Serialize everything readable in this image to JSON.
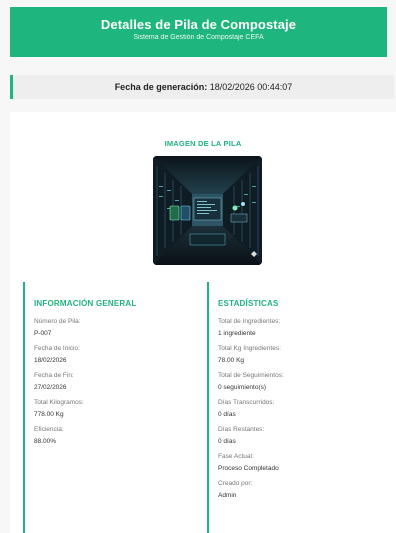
{
  "header": {
    "title": "Detalles de Pila de Compostaje",
    "subtitle": "Sistema de Gestión de Compostaje CEFA"
  },
  "generated": {
    "label": "Fecha de generación:",
    "value": "18/02/2026 00:44:07"
  },
  "image_section": {
    "title": "IMAGEN DE LA PILA"
  },
  "general": {
    "title": "INFORMACIÓN GENERAL",
    "fields": [
      {
        "label": "Número de Pila:",
        "value": "P-007"
      },
      {
        "label": "Fecha de Inicio:",
        "value": "18/02/2026"
      },
      {
        "label": "Fecha de Fin:",
        "value": "27/02/2026"
      },
      {
        "label": "Total Kilogramos:",
        "value": "778.00 Kg"
      },
      {
        "label": "Eficiencia:",
        "value": "88.00%"
      }
    ]
  },
  "stats": {
    "title": "ESTADÍSTICAS",
    "fields": [
      {
        "label": "Total de Ingredientes:",
        "value": "1 ingrediente"
      },
      {
        "label": "Total Kg Ingredientes:",
        "value": "78.00 Kg"
      },
      {
        "label": "Total de Seguimientos:",
        "value": "0 seguimiento(s)"
      },
      {
        "label": "Días Transcurridos:",
        "value": "0 días"
      },
      {
        "label": "Días Restantes:",
        "value": "0 días"
      },
      {
        "label": "Fase Actual:",
        "value": "Proceso Completado"
      },
      {
        "label": "Creado por:",
        "value": "Admin"
      }
    ]
  },
  "colors": {
    "accent": "#1fb57e",
    "background": "#f7f7f7"
  }
}
